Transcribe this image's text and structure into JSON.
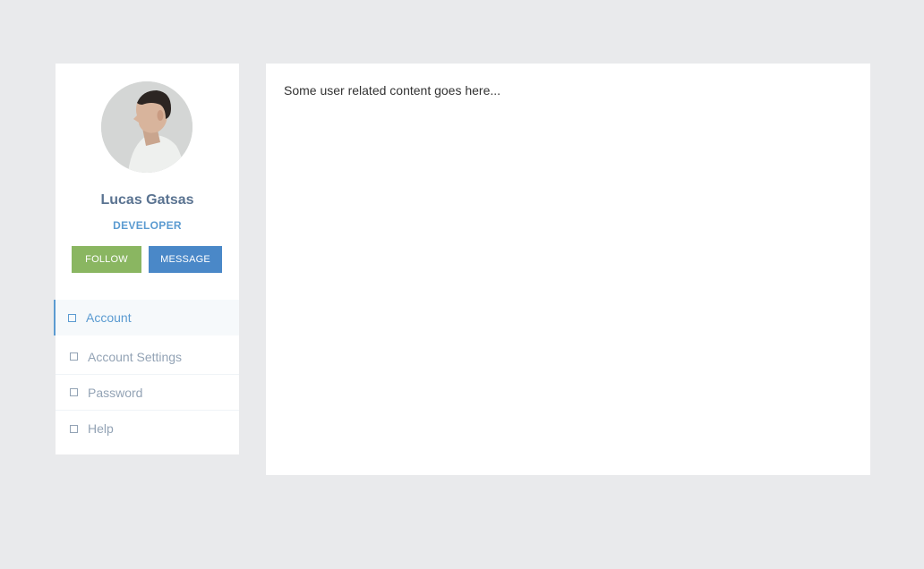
{
  "profile": {
    "name": "Lucas Gatsas",
    "role": "DEVELOPER",
    "follow_label": "FOLLOW",
    "message_label": "MESSAGE"
  },
  "menu": {
    "items": [
      {
        "label": "Account",
        "icon": "square-icon",
        "active": true
      },
      {
        "label": "Account Settings",
        "icon": "square-icon",
        "active": false
      },
      {
        "label": "Password",
        "icon": "square-icon",
        "active": false
      },
      {
        "label": "Help",
        "icon": "square-icon",
        "active": false
      }
    ]
  },
  "content": {
    "text": "Some user related content goes here..."
  },
  "colors": {
    "background": "#e9eaec",
    "accent": "#5b9bd1",
    "follow_button": "#8ab661",
    "message_button": "#4a88c8",
    "name_text": "#5a7391",
    "menu_text": "#93a3b5"
  }
}
